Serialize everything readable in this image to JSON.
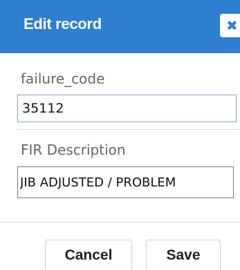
{
  "dialog": {
    "title": "Edit record",
    "close_glyph": "✖"
  },
  "fields": {
    "failure_code": {
      "label": "failure_code",
      "value": "35112"
    },
    "fir_description": {
      "label": "FIR Description",
      "value": "JIB ADJUSTED / PROBLEM"
    }
  },
  "buttons": {
    "cancel": "Cancel",
    "save": "Save"
  },
  "colors": {
    "header": "#2e7fcf",
    "label_text": "#666666"
  }
}
